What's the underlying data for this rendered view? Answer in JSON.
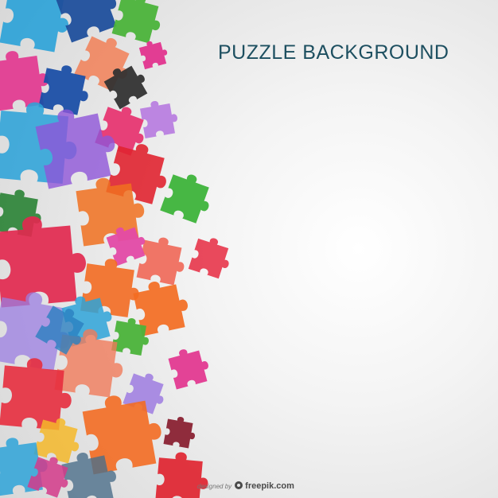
{
  "title": "PUZZLE BACKGROUND",
  "credit": {
    "prefix": "designed by",
    "brand": "freepik.com"
  },
  "colors": {
    "background_center": "#ffffff",
    "background_edge": "#d8d8d8",
    "title_color": "#1d4f60"
  },
  "pieces": [
    {
      "color": "#2ea3d8"
    },
    {
      "color": "#1f4f9c"
    },
    {
      "color": "#4bb33a"
    },
    {
      "color": "#e2348e"
    },
    {
      "color": "#f2794d"
    },
    {
      "color": "#e2348e"
    },
    {
      "color": "#1b4fa6"
    },
    {
      "color": "#333333"
    },
    {
      "color": "#e72d6b"
    },
    {
      "color": "#b980e0"
    },
    {
      "color": "#2ea3d8"
    },
    {
      "color": "#8e55d8"
    },
    {
      "color": "#e02430"
    },
    {
      "color": "#f0701f"
    },
    {
      "color": "#3db33a"
    },
    {
      "color": "#1f7c2a"
    },
    {
      "color": "#e2294f"
    },
    {
      "color": "#f06a5a"
    },
    {
      "color": "#e34aa6"
    },
    {
      "color": "#e73a4e"
    },
    {
      "color": "#f36c22"
    },
    {
      "color": "#f36c22"
    },
    {
      "color": "#9b7de2"
    },
    {
      "color": "#2ea3d8"
    },
    {
      "color": "#4bb33a"
    },
    {
      "color": "#f07a5a"
    },
    {
      "color": "#e2348e"
    },
    {
      "color": "#e72d3e"
    },
    {
      "color": "#9e7be0"
    },
    {
      "color": "#f36c22"
    },
    {
      "color": "#8a2233"
    },
    {
      "color": "#f4b82a"
    },
    {
      "color": "#2ea3d8"
    },
    {
      "color": "#e02430"
    },
    {
      "color": "#4b6e8a"
    },
    {
      "color": "#d33a8a"
    },
    {
      "color": "#2a7fc0"
    },
    {
      "color": "#f07a50"
    }
  ]
}
